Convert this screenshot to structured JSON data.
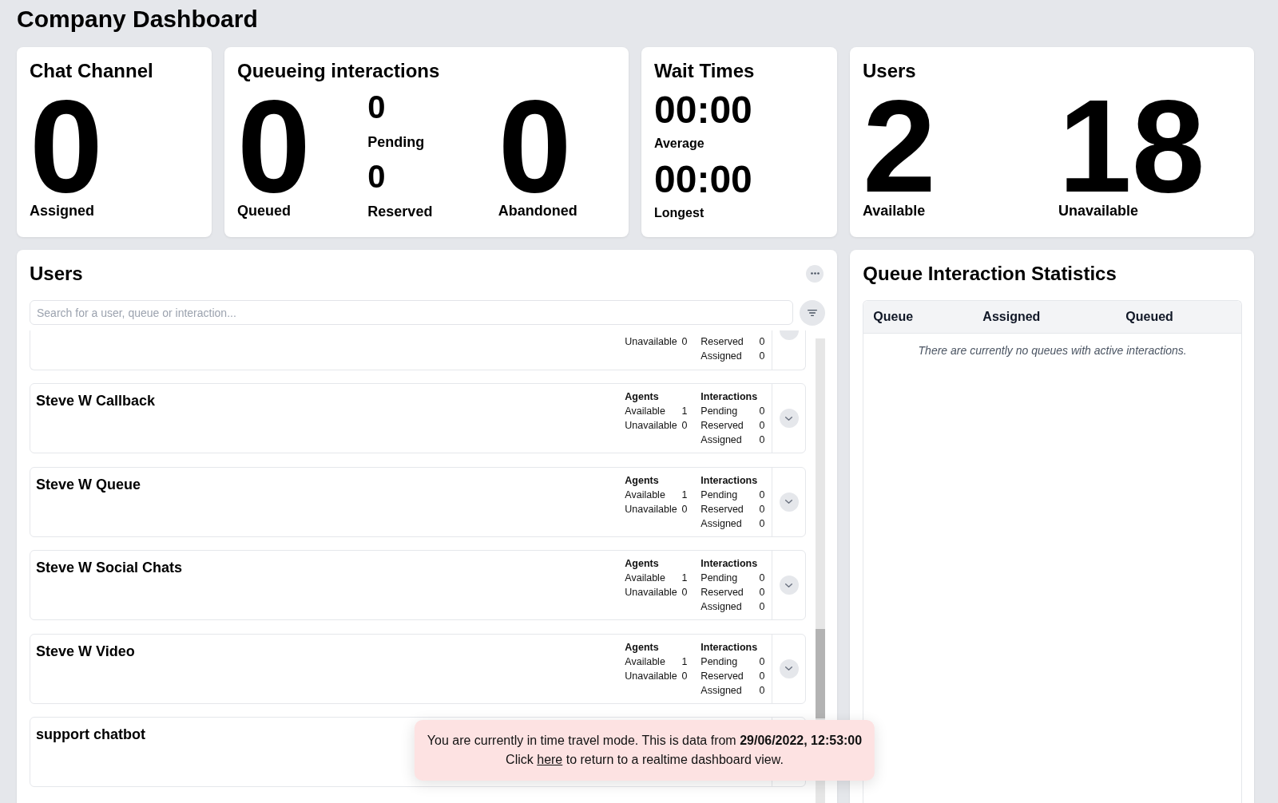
{
  "title": "Company Dashboard",
  "summary_cards": [
    {
      "title": "Chat Channel",
      "columns": [
        {
          "kind": "large",
          "stats": [
            {
              "value": "0",
              "label": "Assigned"
            }
          ]
        }
      ]
    },
    {
      "title": "Queueing interactions",
      "columns": [
        {
          "kind": "large",
          "stats": [
            {
              "value": "0",
              "label": "Queued"
            }
          ]
        },
        {
          "kind": "small",
          "stats": [
            {
              "value": "0",
              "label": "Pending"
            },
            {
              "value": "0",
              "label": "Reserved"
            }
          ]
        },
        {
          "kind": "large",
          "stats": [
            {
              "value": "0",
              "label": "Abandoned"
            }
          ]
        }
      ]
    },
    {
      "title": "Wait Times",
      "columns": [
        {
          "kind": "medium",
          "stats": [
            {
              "value": "00:00",
              "label": "Average"
            },
            {
              "value": "00:00",
              "label": "Longest"
            }
          ]
        }
      ]
    },
    {
      "title": "Users",
      "columns": [
        {
          "kind": "large",
          "stats": [
            {
              "value": "2",
              "label": "Available"
            }
          ]
        },
        {
          "kind": "large",
          "stats": [
            {
              "value": "18",
              "label": "Unavailable"
            }
          ]
        }
      ]
    }
  ],
  "users_panel": {
    "title": "Users",
    "search": {
      "placeholder": "Search for a user, queue or interaction..."
    },
    "queues": [
      {
        "kind": "partial",
        "agents": [
          {
            "label": "Unavailable",
            "value": "0"
          }
        ],
        "interactions": [
          {
            "label": "Reserved",
            "value": "0"
          },
          {
            "label": "Assigned",
            "value": "0"
          }
        ]
      },
      {
        "kind": "full",
        "name": "Steve W Callback",
        "agents_heading": "Agents",
        "interactions_heading": "Interactions",
        "agents": [
          {
            "label": "Available",
            "value": "1"
          },
          {
            "label": "Unavailable",
            "value": "0"
          }
        ],
        "interactions": [
          {
            "label": "Pending",
            "value": "0"
          },
          {
            "label": "Reserved",
            "value": "0"
          },
          {
            "label": "Assigned",
            "value": "0"
          }
        ]
      },
      {
        "kind": "full",
        "name": "Steve W Queue",
        "agents_heading": "Agents",
        "interactions_heading": "Interactions",
        "agents": [
          {
            "label": "Available",
            "value": "1"
          },
          {
            "label": "Unavailable",
            "value": "0"
          }
        ],
        "interactions": [
          {
            "label": "Pending",
            "value": "0"
          },
          {
            "label": "Reserved",
            "value": "0"
          },
          {
            "label": "Assigned",
            "value": "0"
          }
        ]
      },
      {
        "kind": "full",
        "name": "Steve W Social Chats",
        "agents_heading": "Agents",
        "interactions_heading": "Interactions",
        "agents": [
          {
            "label": "Available",
            "value": "1"
          },
          {
            "label": "Unavailable",
            "value": "0"
          }
        ],
        "interactions": [
          {
            "label": "Pending",
            "value": "0"
          },
          {
            "label": "Reserved",
            "value": "0"
          },
          {
            "label": "Assigned",
            "value": "0"
          }
        ]
      },
      {
        "kind": "full",
        "name": "Steve W Video",
        "agents_heading": "Agents",
        "interactions_heading": "Interactions",
        "agents": [
          {
            "label": "Available",
            "value": "1"
          },
          {
            "label": "Unavailable",
            "value": "0"
          }
        ],
        "interactions": [
          {
            "label": "Pending",
            "value": "0"
          },
          {
            "label": "Reserved",
            "value": "0"
          },
          {
            "label": "Assigned",
            "value": "0"
          }
        ]
      },
      {
        "kind": "covered",
        "name": "support chatbot"
      }
    ]
  },
  "queue_statistics": {
    "title": "Queue Interaction Statistics",
    "columns": [
      "Queue",
      "Assigned",
      "Queued"
    ],
    "empty_message": "There are currently no queues with active interactions."
  },
  "toast": {
    "message": "You are currently in time travel mode. This is data from **29/06/2022, 12:53:00**",
    "link_prefix": "Click",
    "link": "here",
    "link_suffix": "to return to a realtime dashboard view."
  }
}
